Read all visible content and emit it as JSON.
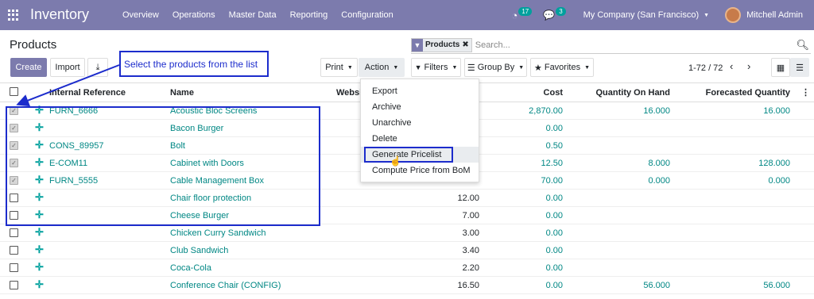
{
  "topbar": {
    "app_title": "Inventory",
    "menu": [
      "Overview",
      "Operations",
      "Master Data",
      "Reporting",
      "Configuration"
    ],
    "activity_count": "17",
    "message_count": "3",
    "company": "My Company (San Francisco)",
    "user": "Mitchell Admin"
  },
  "control_panel": {
    "breadcrumb": "Products",
    "create_label": "Create",
    "import_label": "Import",
    "print_label": "Print",
    "action_label": "Action",
    "filters_label": "Filters",
    "groupby_label": "Group By",
    "favorites_label": "Favorites",
    "search_facet": "Products",
    "search_placeholder": "Search...",
    "pager": "1-72 / 72"
  },
  "action_menu": {
    "items": [
      "Export",
      "Archive",
      "Unarchive",
      "Delete",
      "Generate Pricelist",
      "Compute Price from BoM"
    ],
    "highlighted_index": 4
  },
  "annotation": {
    "callout_text": "Select the products from the list",
    "box_color": "#1c2ccc"
  },
  "table": {
    "columns": [
      "Internal Reference",
      "Name",
      "Websi",
      "Cost",
      "Quantity On Hand",
      "Forecasted Quantity"
    ],
    "rows": [
      {
        "checked": true,
        "ref": "FURN_6666",
        "name": "Acoustic Bloc Screens",
        "price": "",
        "cost": "2,870.00",
        "qty": "16.000",
        "forecast": "16.000"
      },
      {
        "checked": true,
        "ref": "",
        "name": "Bacon Burger",
        "price": "",
        "cost": "0.00",
        "qty": "",
        "forecast": ""
      },
      {
        "checked": true,
        "ref": "CONS_89957",
        "name": "Bolt",
        "price": "",
        "cost": "0.50",
        "qty": "",
        "forecast": ""
      },
      {
        "checked": true,
        "ref": "E-COM11",
        "name": "Cabinet with Doors",
        "price": "",
        "cost": "12.50",
        "qty": "8.000",
        "forecast": "128.000"
      },
      {
        "checked": true,
        "ref": "FURN_5555",
        "name": "Cable Management Box",
        "price": "",
        "cost": "70.00",
        "qty": "0.000",
        "forecast": "0.000"
      },
      {
        "checked": false,
        "ref": "",
        "name": "Chair floor protection",
        "price": "12.00",
        "cost": "0.00",
        "qty": "",
        "forecast": ""
      },
      {
        "checked": false,
        "ref": "",
        "name": "Cheese Burger",
        "price": "7.00",
        "cost": "0.00",
        "qty": "",
        "forecast": ""
      },
      {
        "checked": false,
        "ref": "",
        "name": "Chicken Curry Sandwich",
        "price": "3.00",
        "cost": "0.00",
        "qty": "",
        "forecast": ""
      },
      {
        "checked": false,
        "ref": "",
        "name": "Club Sandwich",
        "price": "3.40",
        "cost": "0.00",
        "qty": "",
        "forecast": ""
      },
      {
        "checked": false,
        "ref": "",
        "name": "Coca-Cola",
        "price": "2.20",
        "cost": "0.00",
        "qty": "",
        "forecast": ""
      },
      {
        "checked": false,
        "ref": "",
        "name": "Conference Chair (CONFIG)",
        "price": "16.50",
        "cost": "0.00",
        "qty": "56.000",
        "forecast": "56.000"
      }
    ]
  }
}
